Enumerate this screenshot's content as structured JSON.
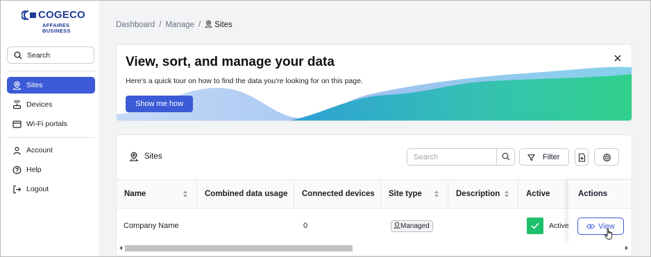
{
  "brand": {
    "name": "COGECO",
    "line1": "AFFAIRES",
    "line2": "BUSINESS"
  },
  "sidebar": {
    "search_label": "Search",
    "items": [
      {
        "label": "Sites",
        "icon": "location-pin-icon",
        "active": true
      },
      {
        "label": "Devices",
        "icon": "router-icon",
        "active": false
      },
      {
        "label": "Wi-Fi portals",
        "icon": "browser-window-icon",
        "active": false
      },
      {
        "label": "Account",
        "icon": "user-icon",
        "active": false
      },
      {
        "label": "Help",
        "icon": "question-circle-icon",
        "active": false
      },
      {
        "label": "Logout",
        "icon": "logout-icon",
        "active": false
      }
    ]
  },
  "breadcrumb": {
    "items": [
      "Dashboard",
      "Manage"
    ],
    "current": "Sites"
  },
  "banner": {
    "title": "View, sort, and manage your data",
    "description": "Here's a quick tour on how to find the data you're looking for on this page.",
    "button": "Show me how"
  },
  "table_card": {
    "title": "Sites",
    "search_placeholder": "Search",
    "filter_label": "Filter",
    "columns": [
      "Name",
      "Combined data usage",
      "Connected devices",
      "Site type",
      "Description",
      "Active",
      "Actions"
    ],
    "rows": [
      {
        "name": "Company Name",
        "combined_data_usage": "",
        "connected_devices": "0",
        "site_type": "Managed",
        "description": "",
        "active": "Active",
        "action": "View"
      }
    ]
  },
  "colors": {
    "accent": "#3d5bd6",
    "success": "#1fc06a",
    "brand": "#1f3a93"
  }
}
